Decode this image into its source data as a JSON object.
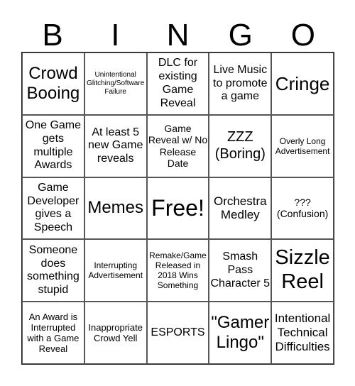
{
  "title_letters": [
    "B",
    "I",
    "N",
    "G",
    "O"
  ],
  "rows": [
    [
      "Crowd Booing",
      "Unintentional Glitching/Software Failure",
      "DLC for existing Game Reveal",
      "Live Music to promote a game",
      "Cringe"
    ],
    [
      "One Game gets multiple Awards",
      "At least 5 new Game reveals",
      "Game Reveal w/ No Release Date",
      "ZZZ (Boring)",
      "Overly Long Advertisement"
    ],
    [
      "Game Developer gives a Speech",
      "Memes",
      "Free!",
      "Orchestra Medley",
      "??? (Confusion)"
    ],
    [
      "Someone does something stupid",
      "Interrupting Advertisement",
      "Remake/Game Released in 2018 Wins Something",
      "Smash Pass Character 5",
      "Sizzle Reel"
    ],
    [
      "An Award is Interrupted with a Game Reveal",
      "Inappropriate Crowd Yell",
      "ESPORTS",
      "\"Gamer Lingo\"",
      "Intentional Technical Difficulties"
    ]
  ]
}
